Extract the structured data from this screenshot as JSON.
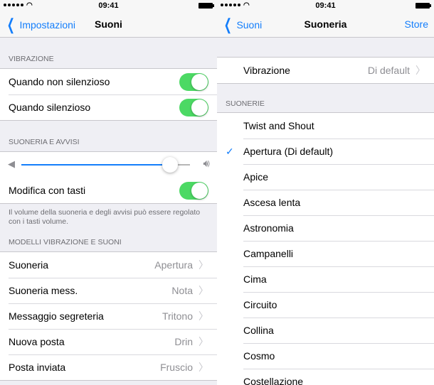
{
  "left": {
    "status": {
      "time": "09:41"
    },
    "nav": {
      "back_label": "Impostazioni",
      "title": "Suoni"
    },
    "vibration": {
      "header": "VIBRAZIONE",
      "items": [
        {
          "label": "Quando non silenzioso",
          "on": true
        },
        {
          "label": "Quando silenzioso",
          "on": true
        }
      ]
    },
    "ringer": {
      "header": "SUONERIA E AVVISI",
      "volume_level": 0.88,
      "change_with_buttons": {
        "label": "Modifica con tasti",
        "on": true
      },
      "note": "Il volume della suoneria e degli avvisi può essere regolato con i tasti volume."
    },
    "patterns": {
      "header": "MODELLI VIBRAZIONE E SUONI",
      "items": [
        {
          "label": "Suoneria",
          "value": "Apertura"
        },
        {
          "label": "Suoneria mess.",
          "value": "Nota"
        },
        {
          "label": "Messaggio segreteria",
          "value": "Tritono"
        },
        {
          "label": "Nuova posta",
          "value": "Drin"
        },
        {
          "label": "Posta inviata",
          "value": "Fruscio"
        }
      ]
    }
  },
  "right": {
    "status": {
      "time": "09:41"
    },
    "nav": {
      "back_label": "Suoni",
      "title": "Suoneria",
      "right_label": "Store"
    },
    "vibration_row": {
      "label": "Vibrazione",
      "value": "Di default"
    },
    "ringtones": {
      "header": "SUONERIE",
      "items": [
        {
          "label": "Twist and Shout",
          "selected": false
        },
        {
          "label": "Apertura (Di default)",
          "selected": true
        },
        {
          "label": "Apice",
          "selected": false
        },
        {
          "label": "Ascesa lenta",
          "selected": false
        },
        {
          "label": "Astronomia",
          "selected": false
        },
        {
          "label": "Campanelli",
          "selected": false
        },
        {
          "label": "Cima",
          "selected": false
        },
        {
          "label": "Circuito",
          "selected": false
        },
        {
          "label": "Collina",
          "selected": false
        },
        {
          "label": "Cosmo",
          "selected": false
        },
        {
          "label": "Costellazione",
          "selected": false
        }
      ]
    }
  },
  "colors": {
    "accent": "#147efb",
    "toggle_on": "#4cd964"
  },
  "icons": {
    "back": "chevron-left-icon",
    "disclosure": "chevron-right-icon",
    "check": "checkmark-icon",
    "volume_low": "speaker-low-icon",
    "volume_high": "speaker-high-icon"
  }
}
